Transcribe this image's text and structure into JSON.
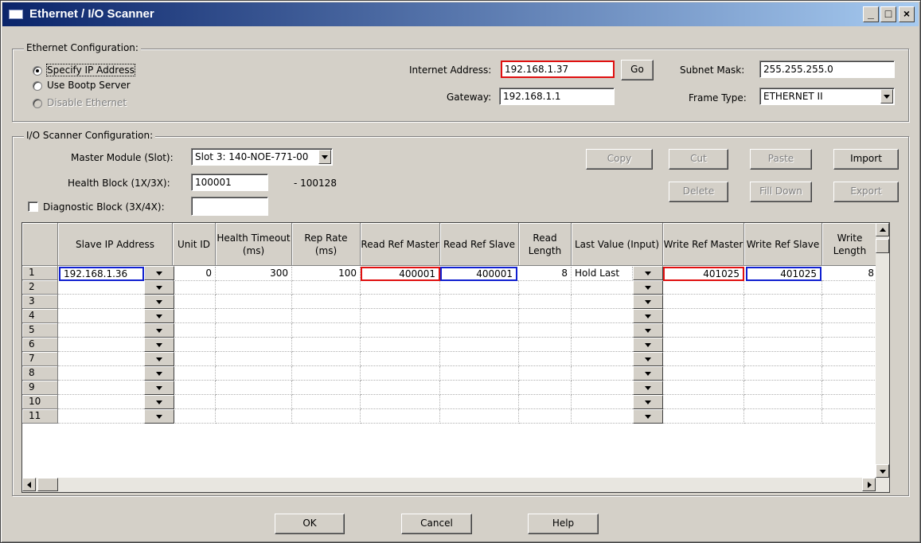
{
  "window": {
    "title": "Ethernet / I/O Scanner",
    "controls": {
      "minimize": "_",
      "maximize": "□",
      "close": "×"
    }
  },
  "ethernet": {
    "group_label": "Ethernet Configuration:",
    "radio_specify": "Specify IP Address",
    "radio_bootp": "Use Bootp Server",
    "radio_disable": "Disable Ethernet",
    "internet_label": "Internet Address:",
    "internet_value": "192.168.1.37",
    "go_label": "Go",
    "gateway_label": "Gateway:",
    "gateway_value": "192.168.1.1",
    "subnet_label": "Subnet Mask:",
    "subnet_value": "255.255.255.0",
    "frame_label": "Frame Type:",
    "frame_value": "ETHERNET II"
  },
  "scanner": {
    "group_label": "I/O Scanner Configuration:",
    "master_label": "Master Module (Slot):",
    "master_value": "Slot 3: 140-NOE-771-00",
    "health_label": "Health Block (1X/3X):",
    "health_value": "100001",
    "health_range": "- 100128",
    "diag_label": "Diagnostic Block (3X/4X):",
    "diag_value": "",
    "buttons": {
      "copy": "Copy",
      "cut": "Cut",
      "paste": "Paste",
      "import": "Import",
      "delete": "Delete",
      "fill_down": "Fill Down",
      "export": "Export"
    }
  },
  "table": {
    "columns": [
      "Slave IP Address",
      "Unit ID",
      "Health Timeout (ms)",
      "Rep Rate (ms)",
      "Read Ref Master",
      "Read Ref Slave",
      "Read Length",
      "Last Value (Input)",
      "Write Ref Master",
      "Write Ref Slave",
      "Write Length"
    ],
    "row_numbers": [
      "1",
      "2",
      "3",
      "4",
      "5",
      "6",
      "7",
      "8",
      "9",
      "10",
      "11"
    ],
    "row1": {
      "slave_ip": "192.168.1.36",
      "unit_id": "0",
      "health_timeout": "300",
      "rep_rate": "100",
      "read_ref_master": "400001",
      "read_ref_slave": "400001",
      "read_length": "8",
      "last_value": "Hold Last",
      "write_ref_master": "401025",
      "write_ref_slave": "401025",
      "write_length": "8"
    }
  },
  "footer": {
    "ok": "OK",
    "cancel": "Cancel",
    "help": "Help"
  },
  "colors": {
    "title_bar": "#0a246a",
    "highlight_red": "#e01010",
    "highlight_blue": "#1020d0",
    "face": "#d4d0c8"
  }
}
